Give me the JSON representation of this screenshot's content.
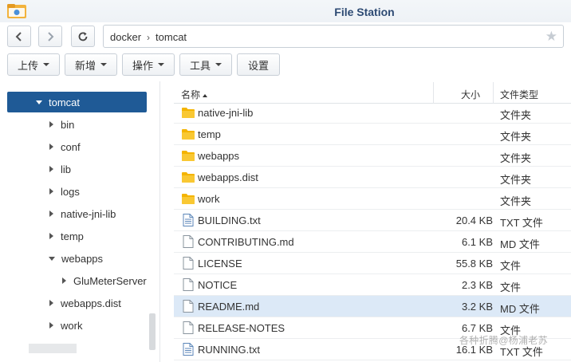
{
  "window": {
    "title": "File Station"
  },
  "nav": {
    "breadcrumb": [
      "docker",
      "tomcat"
    ]
  },
  "toolbar": {
    "upload_label": "上传",
    "create_label": "新增",
    "action_label": "操作",
    "tools_label": "工具",
    "settings_label": "设置"
  },
  "tree": {
    "selected": "tomcat",
    "items": [
      {
        "label": "tomcat",
        "state": "expanded",
        "selected": true
      },
      {
        "label": "bin",
        "state": "collapsed"
      },
      {
        "label": "conf",
        "state": "collapsed"
      },
      {
        "label": "lib",
        "state": "collapsed"
      },
      {
        "label": "logs",
        "state": "collapsed"
      },
      {
        "label": "native-jni-lib",
        "state": "collapsed"
      },
      {
        "label": "temp",
        "state": "collapsed"
      },
      {
        "label": "webapps",
        "state": "expanded"
      },
      {
        "label": "GluMeterServer",
        "state": "collapsed"
      },
      {
        "label": "webapps.dist",
        "state": "collapsed"
      },
      {
        "label": "work",
        "state": "collapsed"
      }
    ]
  },
  "filelist": {
    "columns": {
      "name": "名称",
      "size": "大小",
      "type": "文件类型"
    },
    "rows": [
      {
        "name": "native-jni-lib",
        "size": "",
        "type": "文件夹",
        "kind": "folder"
      },
      {
        "name": "temp",
        "size": "",
        "type": "文件夹",
        "kind": "folder"
      },
      {
        "name": "webapps",
        "size": "",
        "type": "文件夹",
        "kind": "folder"
      },
      {
        "name": "webapps.dist",
        "size": "",
        "type": "文件夹",
        "kind": "folder"
      },
      {
        "name": "work",
        "size": "",
        "type": "文件夹",
        "kind": "folder"
      },
      {
        "name": "BUILDING.txt",
        "size": "20.4 KB",
        "type": "TXT 文件",
        "kind": "txt"
      },
      {
        "name": "CONTRIBUTING.md",
        "size": "6.1 KB",
        "type": "MD 文件",
        "kind": "file"
      },
      {
        "name": "LICENSE",
        "size": "55.8 KB",
        "type": "文件",
        "kind": "file"
      },
      {
        "name": "NOTICE",
        "size": "2.3 KB",
        "type": "文件",
        "kind": "file"
      },
      {
        "name": "README.md",
        "size": "3.2 KB",
        "type": "MD 文件",
        "kind": "file",
        "highlighted": true
      },
      {
        "name": "RELEASE-NOTES",
        "size": "6.7 KB",
        "type": "文件",
        "kind": "file"
      },
      {
        "name": "RUNNING.txt",
        "size": "16.1 KB",
        "type": "TXT 文件",
        "kind": "txt"
      }
    ]
  },
  "watermark": "各种折腾@杨浦老苏",
  "colors": {
    "title": "#2d4a73",
    "selected_tree_bg": "#1f5a96",
    "row_highlight": "#dce9f7",
    "folder": "#f4b400"
  }
}
